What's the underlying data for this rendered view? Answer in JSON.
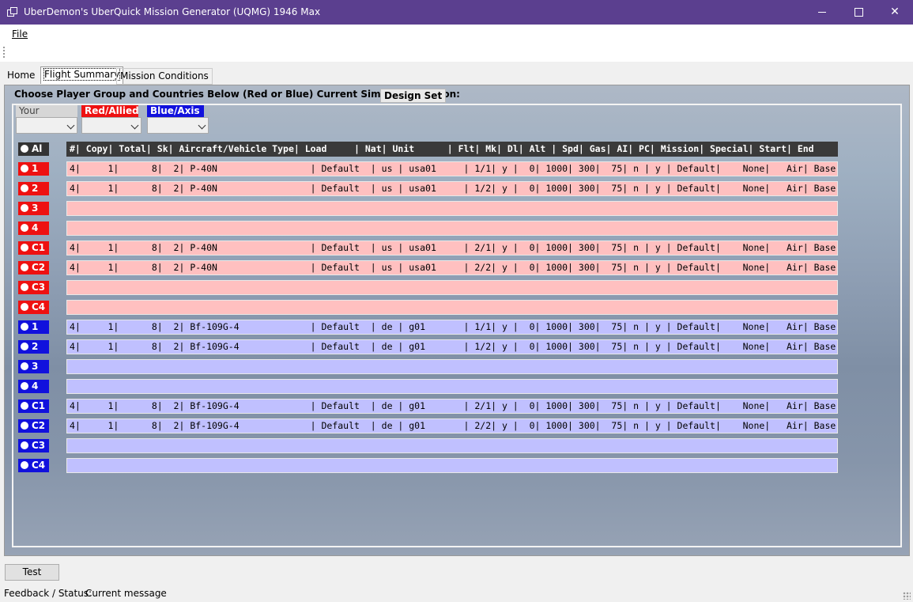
{
  "window": {
    "title": "UberDemon's UberQuick Mission Generator (UQMG) 1946 Max",
    "min_glyph": "—",
    "max_glyph": "☐",
    "close_glyph": "✕"
  },
  "menu": {
    "file": "File"
  },
  "tabs": [
    "Home",
    "Flight Summary",
    "Mission Conditions"
  ],
  "panel": {
    "instruction": "Choose Player Group and Countries Below (Red or Blue)  Current Simulator Version:",
    "version_button": "Design Set",
    "your_position": "Your Position",
    "red_label": "Red/Allied",
    "blue_label": "Blue/Axis",
    "all_label": "Al",
    "header": "#| Copy| Total| Sk| Aircraft/Vehicle Type| Load     | Nat| Unit      | Flt| Mk| Dl| Alt | Spd| Gas| AI| PC| Mission| Special| Start| End",
    "slots": [
      {
        "side": "red",
        "label": "1",
        "text": "4|     1|      8|  2| P-40N                 | Default  | us | usa01     | 1/1| y |  0| 1000| 300|  75| n | y | Default|    None|   Air| Base"
      },
      {
        "side": "red",
        "label": "2",
        "text": "4|     1|      8|  2| P-40N                 | Default  | us | usa01     | 1/2| y |  0| 1000| 300|  75| n | y | Default|    None|   Air| Base"
      },
      {
        "side": "red",
        "label": "3",
        "text": ""
      },
      {
        "side": "red",
        "label": "4",
        "text": ""
      },
      {
        "side": "red",
        "label": "C1",
        "text": "4|     1|      8|  2| P-40N                 | Default  | us | usa01     | 2/1| y |  0| 1000| 300|  75| n | y | Default|    None|   Air| Base"
      },
      {
        "side": "red",
        "label": "C2",
        "text": "4|     1|      8|  2| P-40N                 | Default  | us | usa01     | 2/2| y |  0| 1000| 300|  75| n | y | Default|    None|   Air| Base"
      },
      {
        "side": "red",
        "label": "C3",
        "text": ""
      },
      {
        "side": "red",
        "label": "C4",
        "text": ""
      },
      {
        "side": "blue",
        "label": "1",
        "text": "4|     1|      8|  2| Bf-109G-4             | Default  | de | g01       | 1/1| y |  0| 1000| 300|  75| n | y | Default|    None|   Air| Base"
      },
      {
        "side": "blue",
        "label": "2",
        "text": "4|     1|      8|  2| Bf-109G-4             | Default  | de | g01       | 1/2| y |  0| 1000| 300|  75| n | y | Default|    None|   Air| Base"
      },
      {
        "side": "blue",
        "label": "3",
        "text": ""
      },
      {
        "side": "blue",
        "label": "4",
        "text": ""
      },
      {
        "side": "blue",
        "label": "C1",
        "text": "4|     1|      8|  2| Bf-109G-4             | Default  | de | g01       | 2/1| y |  0| 1000| 300|  75| n | y | Default|    None|   Air| Base"
      },
      {
        "side": "blue",
        "label": "C2",
        "text": "4|     1|      8|  2| Bf-109G-4             | Default  | de | g01       | 2/2| y |  0| 1000| 300|  75| n | y | Default|    None|   Air| Base"
      },
      {
        "side": "blue",
        "label": "C3",
        "text": ""
      },
      {
        "side": "blue",
        "label": "C4",
        "text": ""
      }
    ]
  },
  "test_button": "Test",
  "status": {
    "label": "Feedback / Status:",
    "message": "Current message"
  },
  "colors": {
    "titlebar": "#5b3f8f",
    "red": "#ee1111",
    "blue": "#1111dd",
    "red_row": "#ffc0c0",
    "blue_row": "#c0c0ff"
  }
}
